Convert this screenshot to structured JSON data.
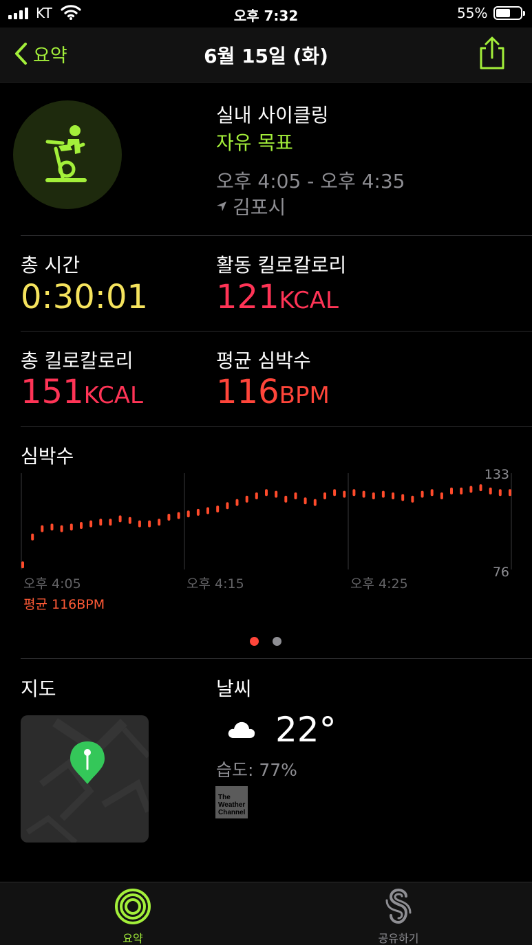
{
  "status_bar": {
    "carrier": "KT",
    "time": "오후 7:32",
    "battery": "55%"
  },
  "nav": {
    "back_label": "요약",
    "title": "6월 15일 (화)"
  },
  "workout": {
    "type": "실내 사이클링",
    "goal": "자유 목표",
    "time_range": "오후 4:05 - 오후 4:35",
    "location": "김포시"
  },
  "metrics": {
    "total_time": {
      "label": "총 시간",
      "value": "0:30:01"
    },
    "active_calories": {
      "label": "활동 킬로칼로리",
      "value": "121",
      "unit": "KCAL"
    },
    "total_calories": {
      "label": "총 킬로칼로리",
      "value": "151",
      "unit": "KCAL"
    },
    "avg_heart_rate": {
      "label": "평균 심박수",
      "value": "116",
      "unit": "BPM"
    }
  },
  "heart_rate": {
    "title": "심박수",
    "average_label": "평균 116BPM"
  },
  "chart_data": {
    "type": "scatter",
    "x_unit": "minutes",
    "ylim": [
      76,
      133
    ],
    "y_tick_labels": [
      "133",
      "76"
    ],
    "x_tick_labels": [
      "오후 4:05",
      "오후 4:15",
      "오후 4:25"
    ],
    "color": "#ff4b2b",
    "x": [
      0,
      0.6,
      1.2,
      1.8,
      2.4,
      3.0,
      3.6,
      4.2,
      4.8,
      5.4,
      6.0,
      6.6,
      7.2,
      7.8,
      8.4,
      9.0,
      9.6,
      10.2,
      10.8,
      11.4,
      12.0,
      12.6,
      13.2,
      13.8,
      14.4,
      15.0,
      15.6,
      16.2,
      16.8,
      17.4,
      18.0,
      18.6,
      19.2,
      19.8,
      20.4,
      21.0,
      21.6,
      22.2,
      22.8,
      23.4,
      24.0,
      24.6,
      25.2,
      25.8,
      26.4,
      27.0,
      27.6,
      28.2,
      28.8,
      29.4,
      30.0
    ],
    "values": [
      78,
      95,
      100,
      101,
      100,
      101,
      102,
      103,
      104,
      104,
      106,
      105,
      103,
      103,
      104,
      107,
      108,
      109,
      110,
      111,
      112,
      114,
      116,
      118,
      120,
      122,
      121,
      118,
      120,
      117,
      116,
      120,
      122,
      121,
      122,
      121,
      120,
      121,
      120,
      119,
      118,
      121,
      122,
      120,
      123,
      123,
      124,
      125,
      123,
      122,
      122
    ]
  },
  "page_dots": {
    "active_color": "#ff453a",
    "inactive_color": "#8e8e93"
  },
  "map": {
    "title": "지도"
  },
  "weather": {
    "title": "날씨",
    "temperature": "22°",
    "humidity": "습도: 77%",
    "provider_lines": [
      "The",
      "Weather",
      "Channel"
    ]
  },
  "tabs": [
    {
      "label": "요약",
      "active": true
    },
    {
      "label": "공유하기",
      "active": false
    }
  ],
  "colors": {
    "accent": "#a3ef3a",
    "yellow": "#f5e35d",
    "red": "#ff3456",
    "orange": "#ff453a"
  }
}
